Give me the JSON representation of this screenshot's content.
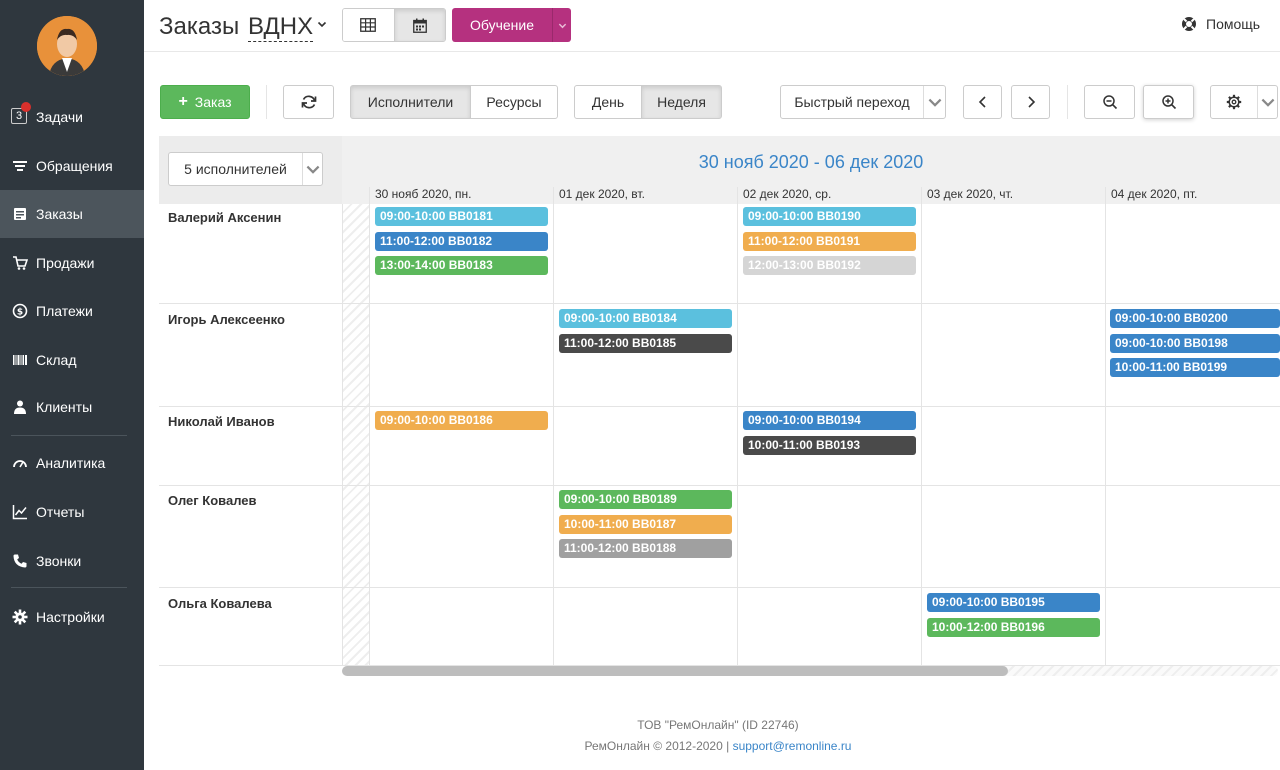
{
  "sidebar": {
    "tasks_badge": "3",
    "items": [
      {
        "label": "Задачи"
      },
      {
        "label": "Обращения"
      },
      {
        "label": "Заказы"
      },
      {
        "label": "Продажи"
      },
      {
        "label": "Платежи"
      },
      {
        "label": "Склад"
      },
      {
        "label": "Клиенты"
      },
      {
        "label": "Аналитика"
      },
      {
        "label": "Отчеты"
      },
      {
        "label": "Звонки"
      },
      {
        "label": "Настройки"
      }
    ]
  },
  "header": {
    "title": "Заказы",
    "location": "ВДНХ",
    "training_label": "Обучение",
    "help_label": "Помощь"
  },
  "toolbar": {
    "new_order_label": "Заказ",
    "performers_tab": "Исполнители",
    "resources_tab": "Ресурсы",
    "day_tab": "День",
    "week_tab": "Неделя",
    "quick_jump_label": "Быстрый переход"
  },
  "calendar": {
    "performers_filter": "5 исполнителей",
    "date_range": "30 нояб 2020 - 06 дек 2020",
    "days": [
      "30 нояб 2020, пн.",
      "01 дек 2020, вт.",
      "02 дек 2020, ср.",
      "03 дек 2020, чт.",
      "04 дек 2020, пт."
    ],
    "people": [
      "Валерий Аксенин",
      "Игорь Алексеенко",
      "Николай Иванов",
      "Олег Ковалев",
      "Ольга Ковалева"
    ],
    "events": [
      {
        "person": 0,
        "day": 0,
        "slot": 0,
        "label": "09:00-10:00 BB0181",
        "color": "#5bc0de"
      },
      {
        "person": 0,
        "day": 0,
        "slot": 1,
        "label": "11:00-12:00 BB0182",
        "color": "#3a85c8"
      },
      {
        "person": 0,
        "day": 0,
        "slot": 2,
        "label": "13:00-14:00 BB0183",
        "color": "#5cb85c"
      },
      {
        "person": 0,
        "day": 2,
        "slot": 0,
        "label": "09:00-10:00 BB0190",
        "color": "#5bc0de"
      },
      {
        "person": 0,
        "day": 2,
        "slot": 1,
        "label": "11:00-12:00 BB0191",
        "color": "#f0ad4e"
      },
      {
        "person": 0,
        "day": 2,
        "slot": 2,
        "label": "12:00-13:00 BB0192",
        "color": "#d5d5d5"
      },
      {
        "person": 1,
        "day": 1,
        "slot": 0,
        "label": "09:00-10:00 BB0184",
        "color": "#5bc0de"
      },
      {
        "person": 1,
        "day": 1,
        "slot": 1,
        "label": "11:00-12:00 BB0185",
        "color": "#4a4a4a"
      },
      {
        "person": 1,
        "day": 4,
        "slot": 0,
        "label": "09:00-10:00 BB0200",
        "color": "#3a85c8"
      },
      {
        "person": 1,
        "day": 4,
        "slot": 1,
        "label": "09:00-10:00 BB0198",
        "color": "#3a85c8"
      },
      {
        "person": 1,
        "day": 4,
        "slot": 2,
        "label": "10:00-11:00 BB0199",
        "color": "#3a85c8"
      },
      {
        "person": 2,
        "day": 0,
        "slot": 0,
        "label": "09:00-10:00 BB0186",
        "color": "#f0ad4e"
      },
      {
        "person": 2,
        "day": 2,
        "slot": 0,
        "label": "09:00-10:00 BB0194",
        "color": "#3a85c8"
      },
      {
        "person": 2,
        "day": 2,
        "slot": 1,
        "label": "10:00-11:00 BB0193",
        "color": "#4a4a4a"
      },
      {
        "person": 3,
        "day": 1,
        "slot": 0,
        "label": "09:00-10:00 BB0189",
        "color": "#5cb85c"
      },
      {
        "person": 3,
        "day": 1,
        "slot": 1,
        "label": "10:00-11:00 BB0187",
        "color": "#f0ad4e"
      },
      {
        "person": 3,
        "day": 1,
        "slot": 2,
        "label": "11:00-12:00 BB0188",
        "color": "#a0a0a0"
      },
      {
        "person": 4,
        "day": 3,
        "slot": 0,
        "label": "09:00-10:00 BB0195",
        "color": "#3a85c8"
      },
      {
        "person": 4,
        "day": 3,
        "slot": 1,
        "label": "10:00-12:00 BB0196",
        "color": "#5cb85c"
      }
    ]
  },
  "footer": {
    "company": "ТОВ \"РемОнлайн\" (ID 22746)",
    "copyright": "РемОнлайн © 2012-2020 |",
    "support_link": "support@remonline.ru"
  },
  "colors": {
    "sidebar_bg": "#2f373e",
    "accent_blue": "#3a85c8",
    "primary_green": "#5cb85c",
    "training_purple": "#b5317f"
  }
}
